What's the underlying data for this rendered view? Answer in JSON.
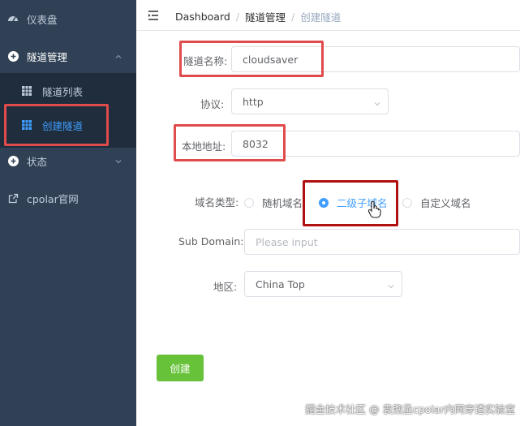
{
  "sidebar": {
    "items": [
      {
        "label": "仪表盘",
        "icon": "dashboard-icon"
      },
      {
        "label": "隧道管理",
        "icon": "plus-circle-icon"
      },
      {
        "label": "状态",
        "icon": "plus-circle-icon"
      },
      {
        "label": "cpolar官网",
        "icon": "external-link-icon"
      }
    ],
    "submenu": [
      {
        "label": "隧道列表",
        "icon": "grid-icon"
      },
      {
        "label": "创建隧道",
        "icon": "grid-icon",
        "active": true
      }
    ]
  },
  "header": {
    "breadcrumb": [
      "Dashboard",
      "隧道管理",
      "创建隧道"
    ],
    "separator": "/"
  },
  "form": {
    "tunnel_name_label": "隧道名称:",
    "tunnel_name_value": "cloudsaver",
    "protocol_label": "协议:",
    "protocol_value": "http",
    "local_addr_label": "本地地址:",
    "local_addr_value": "8032",
    "domain_type_label": "域名类型:",
    "domain_options": [
      "随机域名",
      "二级子域名",
      "自定义域名"
    ],
    "selected_domain_option": "二级子域名",
    "subdomain_label": "Sub Domain:",
    "subdomain_placeholder": "Please input",
    "region_label": "地区:",
    "region_value": "China Top",
    "create_button": "创建"
  },
  "watermark": "掘金技术社区 @ 袁煦丞cpolar内网穿透实验室",
  "colors": {
    "sidebar_bg": "#304156",
    "submenu_bg": "#1f2d3d",
    "active": "#409eff",
    "create_button": "#67c23a",
    "highlight": "#e04b4b"
  }
}
